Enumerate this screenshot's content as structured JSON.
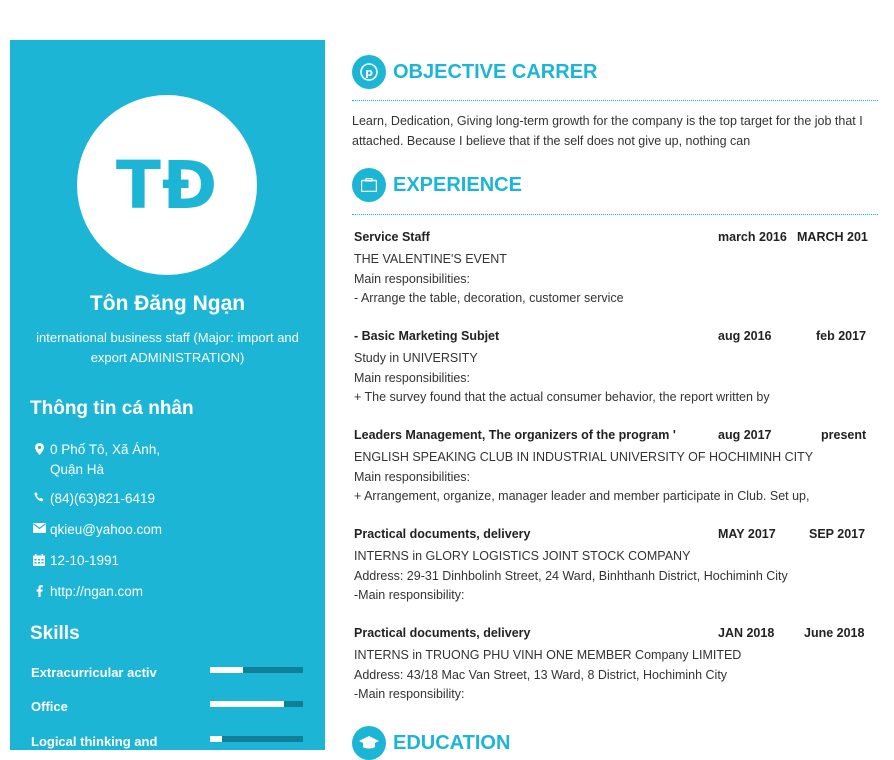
{
  "profile": {
    "initials": "TĐ",
    "name": "Tôn Đăng Ngạn",
    "title": "international business staff (Major: import and export ADMINISTRATION)"
  },
  "personal": {
    "heading": "Thông tin cá nhân",
    "address_line1": "0 Phố Tô, Xã Ánh,",
    "address_line2": "Quận Hà",
    "phone": "(84)(63)821-6419",
    "email": "qkieu@yahoo.com",
    "birthday": "12-10-1991",
    "website": "http://ngan.com"
  },
  "skills": {
    "heading": "Skills",
    "items": [
      {
        "label": "Extracurricular activ",
        "level": 0.35
      },
      {
        "label": "Office",
        "level": 0.8
      },
      {
        "label": "Logical thinking and",
        "level": 0.13
      }
    ]
  },
  "objective": {
    "heading": "OBJECTIVE CARRER",
    "text": "Learn, Dedication, Giving long-term growth for the company is the top target for the job that I attached. Because I believe that if the self does not give up, nothing can"
  },
  "experience": {
    "heading": "EXPERIENCE",
    "jobs": [
      {
        "position": "Service Staff",
        "start": "march 2016",
        "end": "MARCH 201",
        "lines": [
          "THE VALENTINE'S EVENT",
          "Main responsibilities:",
          "- Arrange the table, decoration, customer service"
        ]
      },
      {
        "position": "- Basic Marketing Subjet",
        "start": "aug 2016",
        "end": "feb 2017",
        "lines": [
          "Study in UNIVERSITY",
          "Main responsibilities:",
          "+ The survey found that the actual consumer behavior, the report written by"
        ]
      },
      {
        "position": "Leaders Management, The organizers of the program '",
        "start": "aug 2017",
        "end": "present",
        "lines": [
          "ENGLISH SPEAKING CLUB IN INDUSTRIAL UNIVERSITY OF HOCHIMINH CITY",
          "Main responsibilities:",
          "+ Arrangement, organize, manager leader and member participate in Club. Set up,"
        ]
      },
      {
        "position": "Practical documents, delivery",
        "start": "MAY 2017",
        "end": "SEP 2017",
        "lines": [
          "INTERNS in GLORY LOGISTICS JOINT STOCK COMPANY",
          "Address: 29-31 Dinhbolinh Street, 24 Ward, Binhthanh District, Hochiminh City",
          "-Main responsibility:"
        ]
      },
      {
        "position": "Practical documents, delivery",
        "start": "JAN 2018",
        "end": "June 2018",
        "lines": [
          "INTERNS in TRUONG PHU VINH ONE MEMBER Company LIMITED",
          "Address: 43/18 Mac Van Street, 13 Ward, 8 District, Hochiminh City",
          "-Main responsibility:"
        ]
      }
    ]
  },
  "education": {
    "heading": "EDUCATION"
  },
  "colors": {
    "accent": "#1cb5d6",
    "bar_track": "#127f98"
  }
}
